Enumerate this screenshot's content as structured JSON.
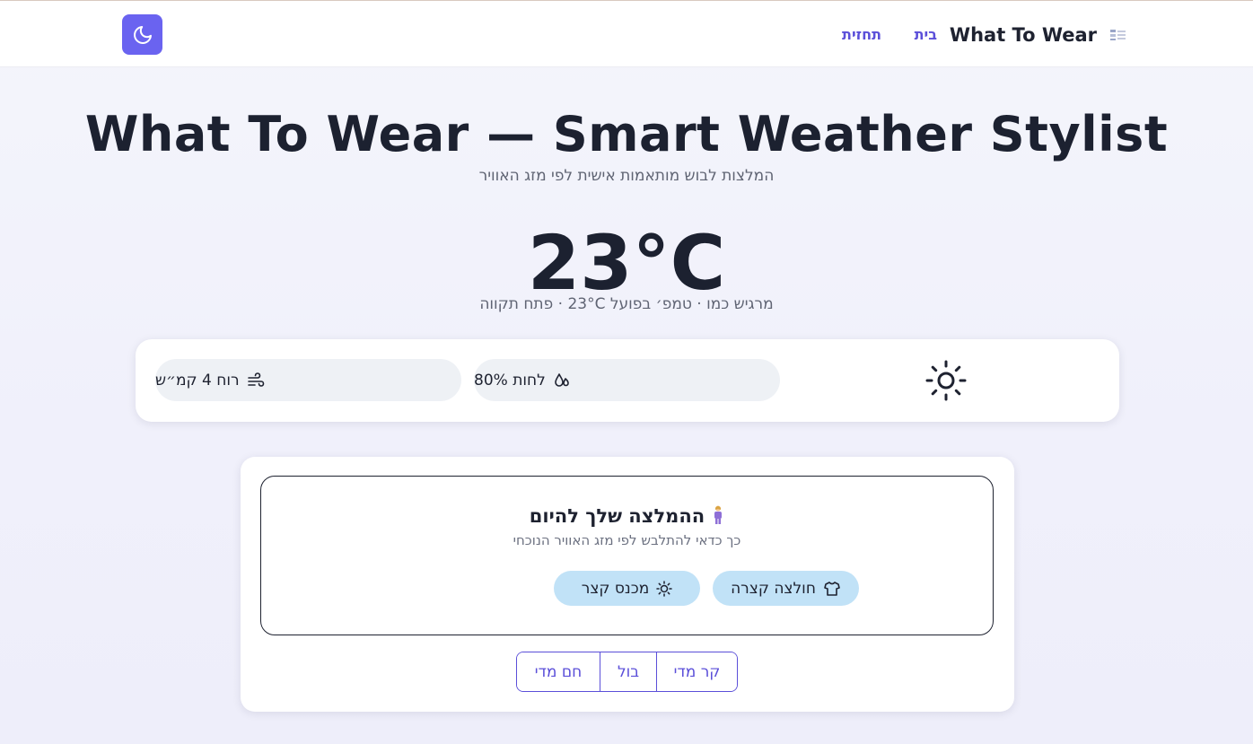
{
  "nav": {
    "brand_title": "What To Wear",
    "links": [
      {
        "label": "בית"
      },
      {
        "label": "תחזית"
      }
    ],
    "theme_toggle_icon": "moon-icon",
    "accent_color": "#6a63f0"
  },
  "hero": {
    "title": "What To Wear — Smart Weather Stylist",
    "subtitle": "המלצות לבוש מותאמות אישית לפי מזג האוויר"
  },
  "weather": {
    "temperature": "23°C",
    "summary": "מרגיש כמו · טמפ׳ בפועל 23°C · פתח תקווה",
    "condition_icon": "sun-icon",
    "humidity_label": "לחות 80%",
    "humidity_icon": "droplets-icon",
    "wind_label": "רוח 4 קמ״ש",
    "wind_icon": "wind-icon"
  },
  "recommendation": {
    "title": "ההמלצה שלך להיום",
    "title_icon": "person-emoji-icon",
    "subtitle": "כך כדאי להתלבש לפי מזג האוויר הנוכחי",
    "items": [
      {
        "label": "חולצה קצרה",
        "icon": "shirt-icon"
      },
      {
        "label": "מכנס קצר",
        "icon": "small-sun-icon"
      }
    ],
    "chip_color": "#c1e2f7"
  },
  "feedback": {
    "options": [
      {
        "label": "קר מדי"
      },
      {
        "label": "בול"
      },
      {
        "label": "חם מדי"
      }
    ]
  }
}
